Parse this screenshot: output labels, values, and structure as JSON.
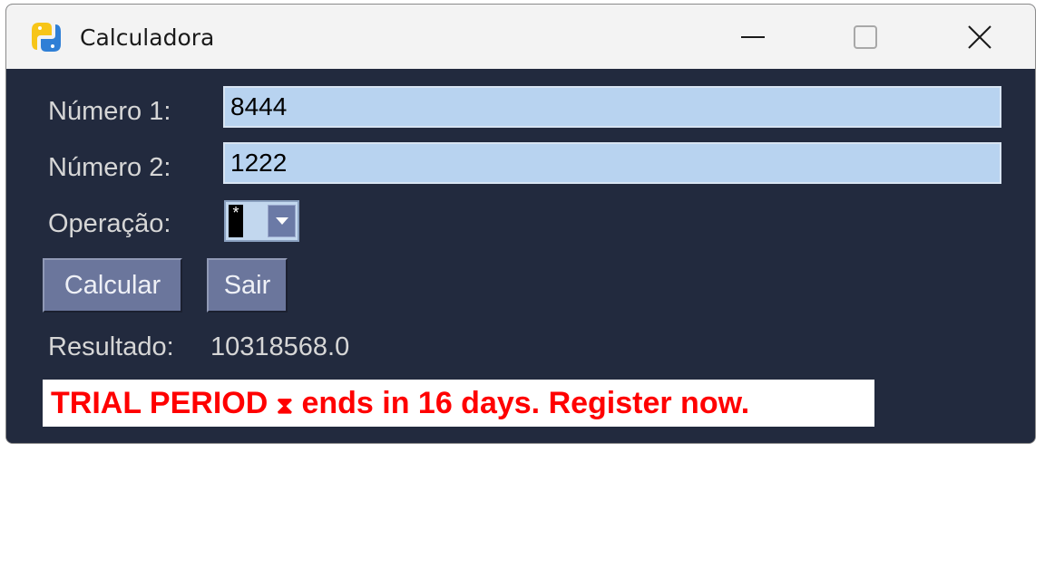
{
  "window": {
    "title": "Calculadora",
    "app_icon": "python-icon",
    "controls": {
      "minimize": "minimize-icon",
      "maximize": "maximize-icon",
      "close": "close-icon"
    }
  },
  "form": {
    "numero1_label": "Número 1:",
    "numero1_value": "8444",
    "numero2_label": "Número 2:",
    "numero2_value": "1222",
    "operacao_label": "Operação:",
    "operacao_value": "*"
  },
  "buttons": {
    "calcular": "Calcular",
    "sair": "Sair"
  },
  "result": {
    "label": "Resultado:",
    "value": "10318568.0"
  },
  "trial_banner": {
    "prefix": "TRIAL PERIOD ",
    "icon": "⧗",
    "suffix": " ends in 16 days. Register now."
  },
  "colors": {
    "client_bg": "#222a3e",
    "titlebar_bg": "#f3f3f3",
    "input_bg": "#b8d3f0",
    "button_bg": "#6b769c",
    "trial_text": "#ff0000"
  }
}
